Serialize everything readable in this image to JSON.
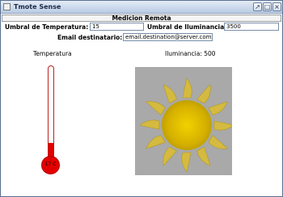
{
  "window": {
    "title": "Tmote Sense",
    "buttons": {
      "restore": "↗",
      "maximize": "□",
      "close": "×"
    }
  },
  "header": {
    "title": "Medicion Remota"
  },
  "form": {
    "temp_label": "Umbral de Temperatura:",
    "temp_value": "15",
    "light_label": "Umbral de Iluminancia:",
    "light_value": "3500",
    "email_label": "Email destinatario:",
    "email_value": "email.destination@server.com"
  },
  "temperature": {
    "title": "Temperatura",
    "reading": "17 C",
    "fill_fraction": 0.18,
    "color": "#e30000"
  },
  "illuminance": {
    "title": "Iluminancia: 500",
    "icon": "sun-icon",
    "color": "#d8b400"
  }
}
